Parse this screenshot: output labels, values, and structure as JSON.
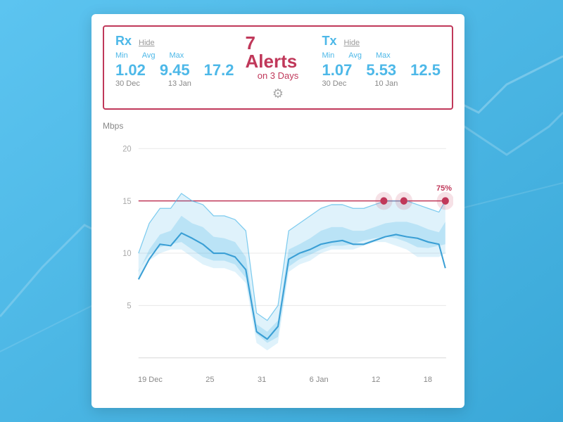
{
  "background": {
    "color": "#4db8e8"
  },
  "card": {
    "rx": {
      "title": "Rx",
      "hide_label": "Hide",
      "min_label": "Min",
      "avg_label": "Avg",
      "max_label": "Max",
      "min_value": "1.02",
      "avg_value": "9.45",
      "max_value": "17.2",
      "min_date": "30 Dec",
      "max_date": "13 Jan"
    },
    "alerts": {
      "count": "7 Alerts",
      "subtitle": "on 3 Days"
    },
    "tx": {
      "title": "Tx",
      "hide_label": "Hide",
      "min_label": "Min",
      "avg_label": "Avg",
      "max_label": "Max",
      "min_value": "1.07",
      "avg_value": "5.53",
      "max_value": "12.5",
      "min_date": "30 Dec",
      "max_date": "10 Jan"
    },
    "chart": {
      "y_label": "Mbps",
      "y_ticks": [
        "20",
        "15",
        "10",
        "5"
      ],
      "x_labels": [
        "19 Dec",
        "25",
        "31",
        "6 Jan",
        "12",
        "18"
      ],
      "threshold_label": "75%"
    }
  }
}
